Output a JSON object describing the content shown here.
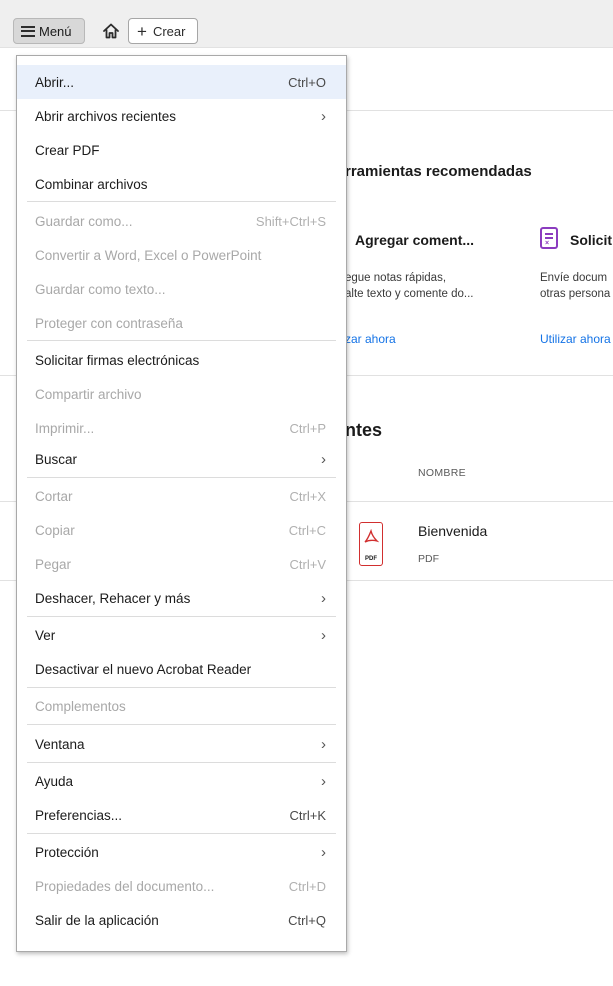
{
  "toolbar": {
    "menu_label": "Menú",
    "create_label": "Crear"
  },
  "background": {
    "recommended_title": "rramientas recomendadas",
    "tool1": {
      "title": "Agregar coment...",
      "desc_line1": "egue notas rápidas,",
      "desc_line2": "alte texto y comente do...",
      "link": "zar ahora"
    },
    "tool2": {
      "title": "Solicit",
      "desc_line1": "Envíe docum",
      "desc_line2": "otras persona",
      "link": "Utilizar ahora"
    },
    "recent_title": "ntes",
    "column_name": "NOMBRE",
    "file": {
      "name": "Bienvenida",
      "type": "PDF",
      "icon_label": "PDF"
    }
  },
  "menu": {
    "items": [
      {
        "label": "Abrir...",
        "shortcut": "Ctrl+O",
        "submenu": false,
        "disabled": false,
        "highlighted": true
      },
      {
        "label": "Abrir archivos recientes",
        "shortcut": "",
        "submenu": true,
        "disabled": false
      },
      {
        "label": "Crear PDF",
        "shortcut": "",
        "submenu": false,
        "disabled": false
      },
      {
        "label": "Combinar archivos",
        "shortcut": "",
        "submenu": false,
        "disabled": false
      },
      {
        "label": "Guardar como...",
        "shortcut": "Shift+Ctrl+S",
        "submenu": false,
        "disabled": true
      },
      {
        "label": "Convertir a Word, Excel o PowerPoint",
        "shortcut": "",
        "submenu": false,
        "disabled": true
      },
      {
        "label": "Guardar como texto...",
        "shortcut": "",
        "submenu": false,
        "disabled": true
      },
      {
        "label": "Proteger con contraseña",
        "shortcut": "",
        "submenu": false,
        "disabled": true
      },
      {
        "label": "Solicitar firmas electrónicas",
        "shortcut": "",
        "submenu": false,
        "disabled": false
      },
      {
        "label": "Compartir archivo",
        "shortcut": "",
        "submenu": false,
        "disabled": true
      },
      {
        "label": "Imprimir...",
        "shortcut": "Ctrl+P",
        "submenu": false,
        "disabled": true
      },
      {
        "label": "Buscar",
        "shortcut": "",
        "submenu": true,
        "disabled": false
      },
      {
        "label": "Cortar",
        "shortcut": "Ctrl+X",
        "submenu": false,
        "disabled": true
      },
      {
        "label": "Copiar",
        "shortcut": "Ctrl+C",
        "submenu": false,
        "disabled": true
      },
      {
        "label": "Pegar",
        "shortcut": "Ctrl+V",
        "submenu": false,
        "disabled": true
      },
      {
        "label": "Deshacer, Rehacer y más",
        "shortcut": "",
        "submenu": true,
        "disabled": false
      },
      {
        "label": "Ver",
        "shortcut": "",
        "submenu": true,
        "disabled": false
      },
      {
        "label": "Desactivar el nuevo Acrobat Reader",
        "shortcut": "",
        "submenu": false,
        "disabled": false
      },
      {
        "label": "Complementos",
        "shortcut": "",
        "submenu": false,
        "disabled": true
      },
      {
        "label": "Ventana",
        "shortcut": "",
        "submenu": true,
        "disabled": false
      },
      {
        "label": "Ayuda",
        "shortcut": "",
        "submenu": true,
        "disabled": false
      },
      {
        "label": "Preferencias...",
        "shortcut": "Ctrl+K",
        "submenu": false,
        "disabled": false
      },
      {
        "label": "Protección",
        "shortcut": "",
        "submenu": true,
        "disabled": false
      },
      {
        "label": "Propiedades del documento...",
        "shortcut": "Ctrl+D",
        "submenu": false,
        "disabled": true
      },
      {
        "label": "Salir de la aplicación",
        "shortcut": "Ctrl+Q",
        "submenu": false,
        "disabled": false
      }
    ]
  }
}
